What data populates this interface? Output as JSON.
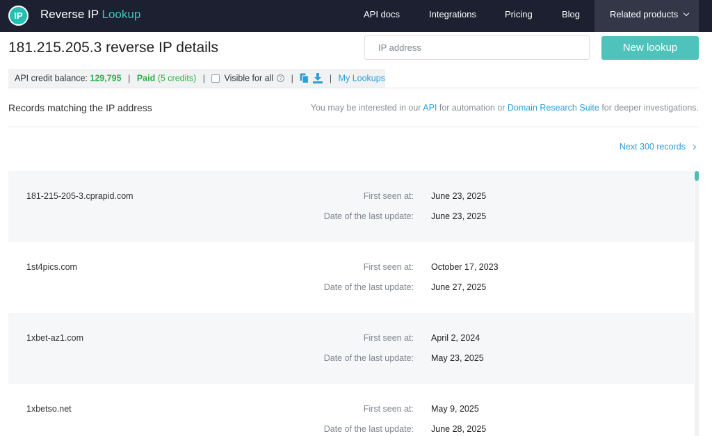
{
  "header": {
    "logo_text": "IP",
    "brand_main": "Reverse IP ",
    "brand_accent": "Lookup",
    "nav": [
      "API docs",
      "Integrations",
      "Pricing",
      "Blog"
    ],
    "related": "Related products"
  },
  "title": "181.215.205.3 reverse IP details",
  "search": {
    "placeholder": "IP address",
    "button": "New lookup"
  },
  "status": {
    "credit_label": "API credit balance: ",
    "credit_value": "129,795",
    "paid": "Paid",
    "paid_credits": " (5 credits)",
    "visible": "Visible for all",
    "help": "?",
    "my_lookups": "My Lookups"
  },
  "records_label": "Records matching the IP address",
  "hint": {
    "pre": "You may be interested in our ",
    "api": "API",
    "mid": " for automation or ",
    "suite": "Domain Research Suite",
    "post": " for deeper investigations."
  },
  "next": "Next 300 records",
  "labels": {
    "first": "First seen at:",
    "last": "Date of the last update:"
  },
  "records": [
    {
      "domain": "181-215-205-3.cprapid.com",
      "first": "June 23, 2025",
      "last": "June 23, 2025"
    },
    {
      "domain": "1st4pics.com",
      "first": "October 17, 2023",
      "last": "June 27, 2025"
    },
    {
      "domain": "1xbet-az1.com",
      "first": "April 2, 2024",
      "last": "May 23, 2025"
    },
    {
      "domain": "1xbetso.net",
      "first": "May 9, 2025",
      "last": "June 28, 2025"
    }
  ],
  "colors": {
    "topbar": "#1c2030",
    "accent": "#4fc3bb",
    "link": "#2d9fd8",
    "green": "#2fb04a"
  }
}
